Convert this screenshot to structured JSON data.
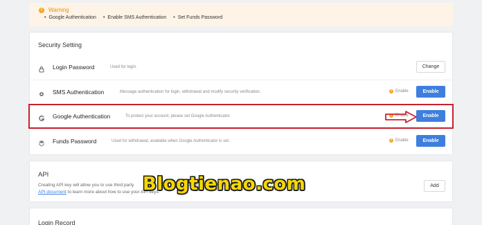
{
  "warning": {
    "title": "Warning",
    "items": [
      "Google Authentication",
      "Enable SMS Authentication",
      "Set Funds Password"
    ]
  },
  "security": {
    "title": "Security Setting",
    "rows": [
      {
        "name": "Login Password",
        "desc": "Used for login.",
        "status": "",
        "button": "Change",
        "icon": "lock-icon"
      },
      {
        "name": "SMS Authentication",
        "desc": "Message authentication for login, withdrawal and modify security verification.",
        "status": "Enable",
        "button": "Enable",
        "icon": "phone-icon"
      },
      {
        "name": "Google Authentication",
        "desc": "To protect your account, please set Google Authenticator.",
        "status": "Enable",
        "button": "Enable",
        "icon": "google-icon"
      },
      {
        "name": "Funds Password",
        "desc": "Used for withdrawal, available when Google Authenticator is set.",
        "status": "Enable",
        "button": "Enable",
        "icon": "shield-icon"
      }
    ]
  },
  "api": {
    "title": "API",
    "desc_before": "Creating API key will allow you to use third party",
    "desc_after": "rading services. Please read the",
    "link": "API document",
    "desc_end": "to learn more about how to use your API keys.",
    "button": "Add"
  },
  "login_record": {
    "title": "Login Record"
  },
  "watermark": "Blogtienao.com",
  "colors": {
    "primary": "#3e7fdd",
    "warning": "#f5a623",
    "highlight": "#c8202a",
    "watermark": "#f6d800"
  }
}
